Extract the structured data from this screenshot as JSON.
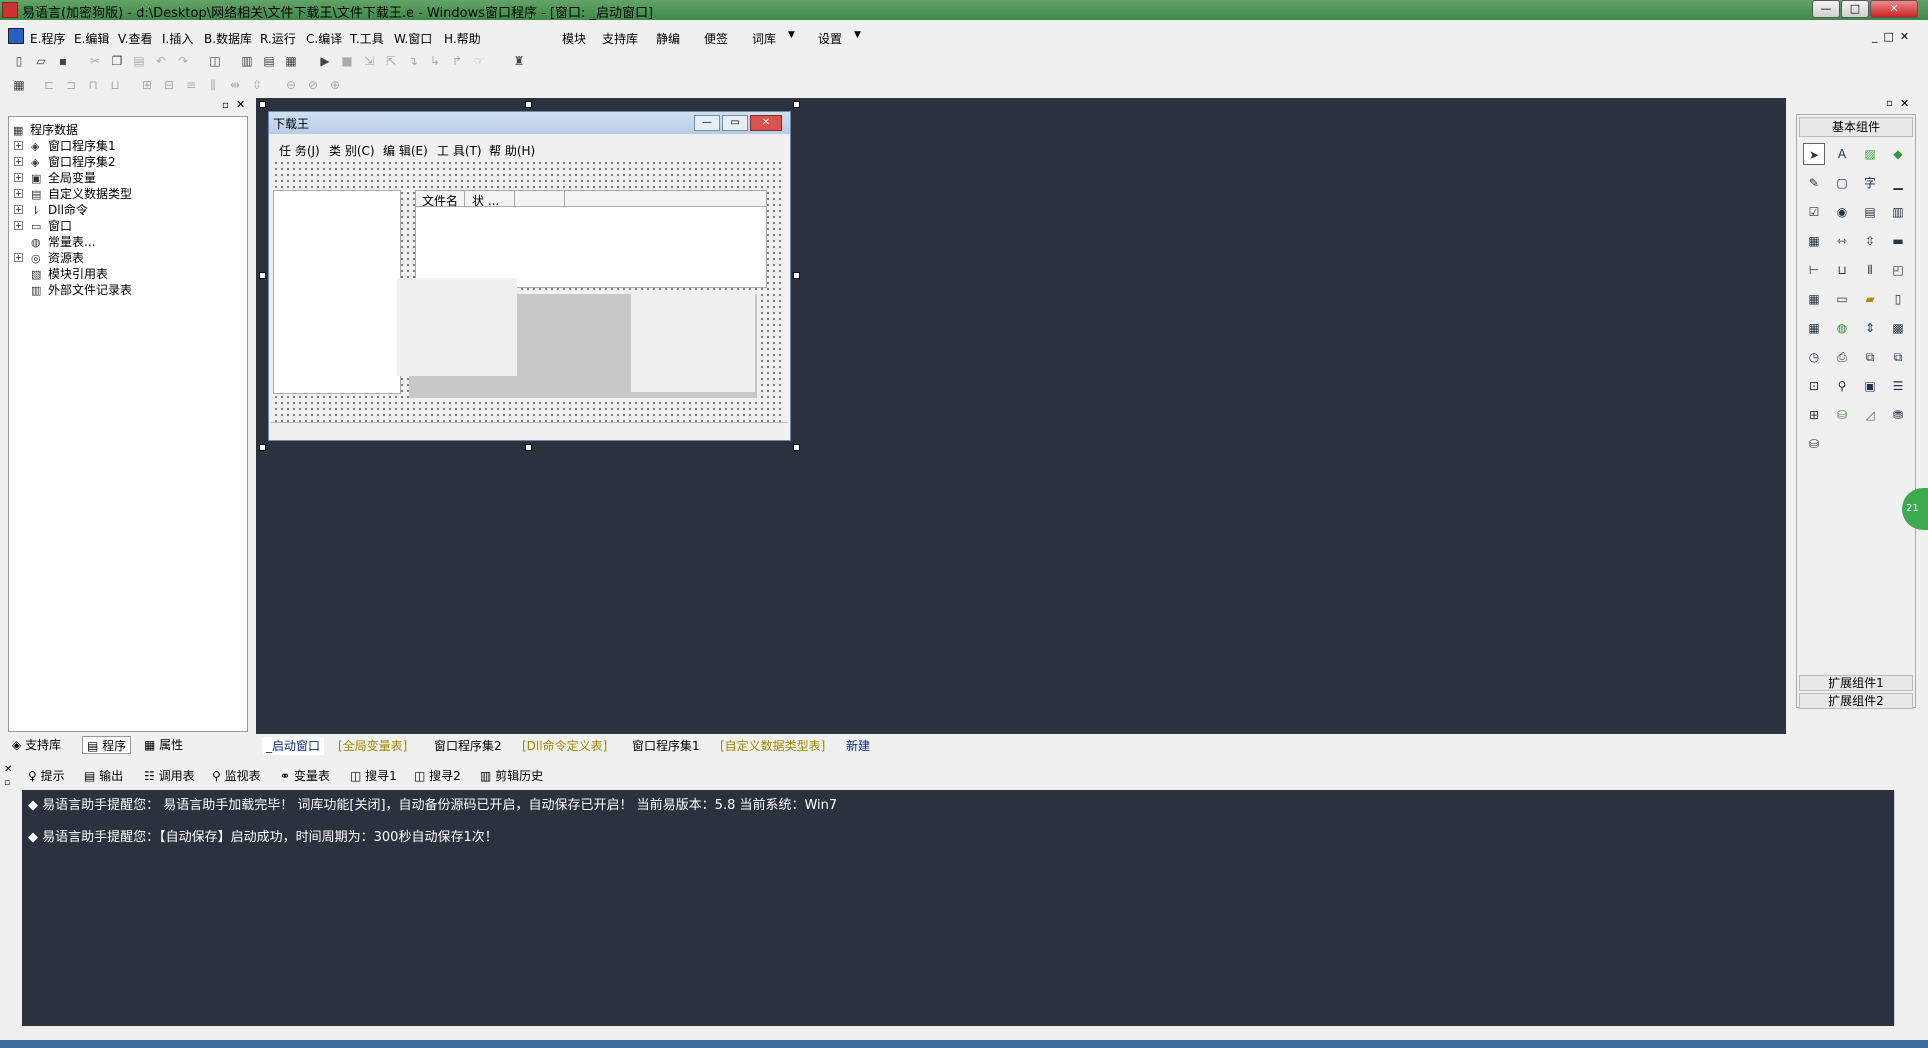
{
  "titlebar": {
    "title": "易语言(加密狗版) - d:\\Desktop\\网络相关\\文件下载王\\文件下载王.e - Windows窗口程序 - [窗口: _启动窗口]",
    "min": "—",
    "max": "□",
    "close": "✕"
  },
  "menu": {
    "items": [
      "E.程序",
      "E.编辑",
      "V.查看",
      "I.插入",
      "B.数据库",
      "R.运行",
      "C.编译",
      "T.工具",
      "W.窗口",
      "H.帮助"
    ],
    "extra": [
      "模块",
      "支持库",
      "静编",
      "便签",
      "词库",
      "设置"
    ],
    "dropdown": "▼"
  },
  "left_panel": {
    "tree": [
      {
        "label": "程序数据",
        "expander": "",
        "icon": "▦"
      },
      {
        "label": "窗口程序集1",
        "expander": "+",
        "icon": "◈"
      },
      {
        "label": "窗口程序集2",
        "expander": "+",
        "icon": "◈"
      },
      {
        "label": "全局变量",
        "expander": "+",
        "icon": "▣"
      },
      {
        "label": "自定义数据类型",
        "expander": "+",
        "icon": "▤"
      },
      {
        "label": "Dll命令",
        "expander": "+",
        "icon": "⇂"
      },
      {
        "label": "窗口",
        "expander": "+",
        "icon": "▭"
      },
      {
        "label": "常量表...",
        "expander": "",
        "icon": "◍"
      },
      {
        "label": "资源表",
        "expander": "+",
        "icon": "◎"
      },
      {
        "label": "模块引用表",
        "expander": "",
        "icon": "▧"
      },
      {
        "label": "外部文件记录表",
        "expander": "",
        "icon": "▥"
      }
    ],
    "tabs": [
      "支持库",
      "程序",
      "属性"
    ]
  },
  "design_form": {
    "title": "下载王",
    "menu": [
      "任 务(J)",
      "类 别(C)",
      "编 辑(E)",
      "工 具(T)",
      "帮 助(H)"
    ],
    "columns": [
      "文件名",
      "状 ..."
    ]
  },
  "right_panel": {
    "header": "基本组件",
    "footer": [
      "扩展组件1",
      "扩展组件2"
    ],
    "edge_label": "21"
  },
  "workspace_tabs": [
    "_启动窗口",
    "[全局变量表]",
    "窗口程序集2",
    "[Dll命令定义表]",
    "窗口程序集1",
    "[自定义数据类型表]",
    "新建"
  ],
  "output": {
    "tabs": [
      "提示",
      "输出",
      "调用表",
      "监视表",
      "变量表",
      "搜寻1",
      "搜寻2",
      "剪辑历史"
    ],
    "lines": [
      "易语言助手提醒您：  易语言助手加载完毕！ 词库功能[关闭]，自动备份源码已开启，自动保存已开启！ 当前易版本：5.8  当前系统：Win7",
      "易语言助手提醒您：【自动保存】启动成功，时间周期为：300秒自动保存1次！"
    ],
    "bullet": "◆"
  },
  "colors": {
    "workspace_bg": "#2b313d",
    "titlebar": "#4f9a58",
    "tab_yellow": "#a08a00",
    "tab_blue": "#0b2a8a"
  }
}
